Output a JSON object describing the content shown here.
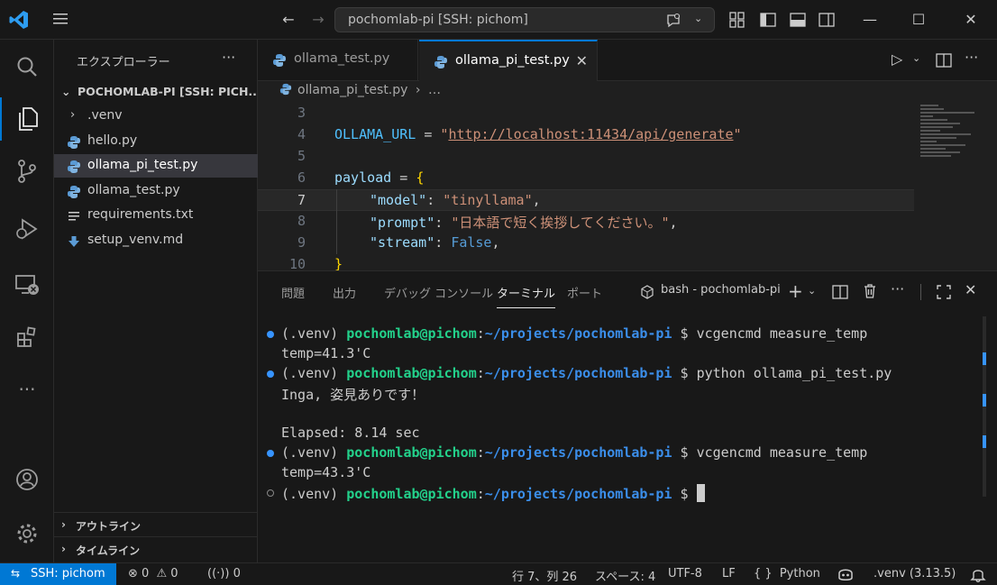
{
  "window": {
    "title": "pochomlab-pi [SSH: pichom]",
    "minimize": "—",
    "maximize": "☐",
    "close": "✕"
  },
  "sidebar": {
    "title": "エクスプローラー",
    "more": "···",
    "root_label": "POCHOMLAB-PI [SSH: PICH...",
    "items": [
      {
        "label": ".venv",
        "type": "folder"
      },
      {
        "label": "hello.py",
        "type": "python"
      },
      {
        "label": "ollama_pi_test.py",
        "type": "python",
        "selected": true
      },
      {
        "label": "ollama_test.py",
        "type": "python"
      },
      {
        "label": "requirements.txt",
        "type": "text"
      },
      {
        "label": "setup_venv.md",
        "type": "markdown"
      }
    ],
    "sections": [
      {
        "label": "アウトライン"
      },
      {
        "label": "タイムライン"
      }
    ]
  },
  "editor": {
    "tabs": [
      {
        "label": "ollama_test.py",
        "active": false
      },
      {
        "label": "ollama_pi_test.py",
        "active": true
      }
    ],
    "breadcrumb": {
      "file": "ollama_pi_test.py",
      "rest": "…"
    },
    "lines": [
      {
        "n": "3"
      },
      {
        "n": "4",
        "var": "OLLAMA_URL",
        "op": " = ",
        "q1": "\"",
        "url": "http://localhost:11434/api/generate",
        "q2": "\""
      },
      {
        "n": "5"
      },
      {
        "n": "6",
        "var": "payload",
        "op": " = ",
        "br": "{"
      },
      {
        "n": "7",
        "key": "\"model\"",
        "sep": ": ",
        "val": "\"tinyllama\"",
        "end": ","
      },
      {
        "n": "8",
        "key": "\"prompt\"",
        "sep": ": ",
        "val": "\"日本語で短く挨拶してください。\"",
        "end": ","
      },
      {
        "n": "9",
        "key": "\"stream\"",
        "sep": ": ",
        "kw": "False",
        "end": ","
      },
      {
        "n": "10",
        "br": "}"
      }
    ]
  },
  "panel": {
    "tabs": [
      {
        "label": "問題",
        "active": false
      },
      {
        "label": "出力",
        "active": false
      },
      {
        "label": "デバッグ コンソール",
        "active": false
      },
      {
        "label": "ターミナル",
        "active": true
      },
      {
        "label": "ポート",
        "active": false
      }
    ],
    "terminal_name": "bash - pochomlab-pi",
    "terminal": {
      "venv": "(.venv) ",
      "user": "pochomlab@pichom",
      "colon": ":",
      "path": "~/projects/pochomlab-pi",
      "prompt": " $ ",
      "cmd1": "vcgencmd measure_temp",
      "out1": "temp=41.3'C",
      "cmd2": "python ollama_pi_test.py",
      "out2": "Inga, 姿見ありです！",
      "out3": "Elapsed: 8.14 sec",
      "cmd3": "vcgencmd measure_temp",
      "out4": "temp=43.3'C"
    }
  },
  "statusbar": {
    "remote": "SSH: pichom",
    "errors": "0",
    "warnings": "0",
    "ports": "0",
    "position": "行 7、列 26",
    "spaces": "スペース: 4",
    "encoding": "UTF-8",
    "eol": "LF",
    "braces": "{ }",
    "language": "Python",
    "interpreter": ".venv (3.13.5)"
  },
  "colors": {
    "accent": "#0078d4",
    "background": "#1f1f1f",
    "terminal_user": "#23d18b",
    "terminal_path": "#3b8eea"
  }
}
